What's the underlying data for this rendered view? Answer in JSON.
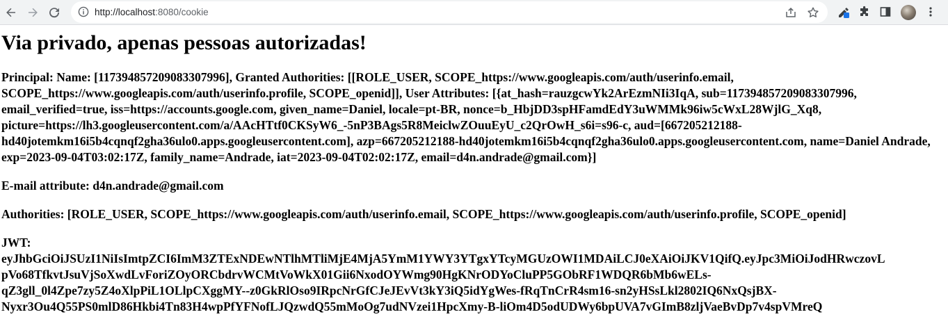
{
  "browser": {
    "url_scheme_host": "http://localhost",
    "url_rest": ":8080/cookie",
    "icons": {
      "back": "arrow-left-icon",
      "forward": "arrow-right-icon",
      "reload": "reload-icon",
      "site_info": "info-icon",
      "share": "share-icon",
      "bookmark": "star-icon",
      "extension_pinned": "pen-extension-icon",
      "extensions": "puzzle-icon",
      "side_panel": "side-panel-icon",
      "profile": "avatar",
      "menu": "kebab-menu-icon"
    },
    "colors": {
      "toolbar_bg": "#f1f3f4",
      "icon": "#5f6368",
      "extension_badge": "#1a73e8"
    }
  },
  "page": {
    "title": "Via privado, apenas pessoas autorizadas!",
    "principal": "Principal: Name: [117394857209083307996], Granted Authorities: [[ROLE_USER, SCOPE_https://www.googleapis.com/auth/userinfo.email, SCOPE_https://www.googleapis.com/auth/userinfo.profile, SCOPE_openid]], User Attributes: [{at_hash=rauzgcwYk2ArEzmNIi3IqA, sub=117394857209083307996, email_verified=true, iss=https://accounts.google.com, given_name=Daniel, locale=pt-BR, nonce=b_HbjDD3spHFamdEdY3uWMMk96iw5cWxL28WjlG_Xq8, picture=https://lh3.googleusercontent.com/a/AAcHTtf0CKSyW6_-5nP3BAgs5R8MeiclwZOuuEyU_c2QrOwH_s6i=s96-c, aud=[667205212188-hd40jotemkm16i5b4cqnqf2gha36ulo0.apps.googleusercontent.com], azp=667205212188-hd40jotemkm16i5b4cqnqf2gha36ulo0.apps.googleusercontent.com, name=Daniel Andrade, exp=2023-09-04T03:02:17Z, family_name=Andrade, iat=2023-09-04T02:02:17Z, email=d4n.andrade@gmail.com}]",
    "email_attribute": "E-mail attribute: d4n.andrade@gmail.com",
    "authorities": "Authorities: [ROLE_USER, SCOPE_https://www.googleapis.com/auth/userinfo.email, SCOPE_https://www.googleapis.com/auth/userinfo.profile, SCOPE_openid]",
    "jwt_label": "JWT:",
    "jwt_lines": [
      "eyJhbGciOiJSUzI1NiIsImtpZCI6ImM3ZTExNDEwNTlhMTliMjE4MjA5YmM1YWY3YTgxYTcyMGUzOWI1MDAiLCJ0eXAiOiJKV1QifQ.eyJpc3MiOiJodHRwczovL",
      "pVo68TfkvtJsuVjSoXwdLvForiZOyORCbdrvWCMtVoWkX01Gii6NxodOYWmg90HgKNrODYoCluPP5GObRF1WDQR6bMb6wELs-",
      "qZ3gll_0l4Zpe7zy5Z4oXlpPiL1OLlpCXggMY--z0GkRlOso9IRpcNrGfCJeJEvVt3kY3iQ5idYgWes-fRqTnCrR4sm16-sn2yHSsLkl2802IQ6NxQsjBX-",
      "Nyxr3Ou4Q55PS0mlD86Hkbi4Tn83H4wpPfYFNofLJQzwdQ55mMoOg7udNVzei1HpcXmy-B-liOm4D5odUDWy6bpUVA7vGImB8zljVaeBvDp7v4spVMreQ"
    ]
  }
}
